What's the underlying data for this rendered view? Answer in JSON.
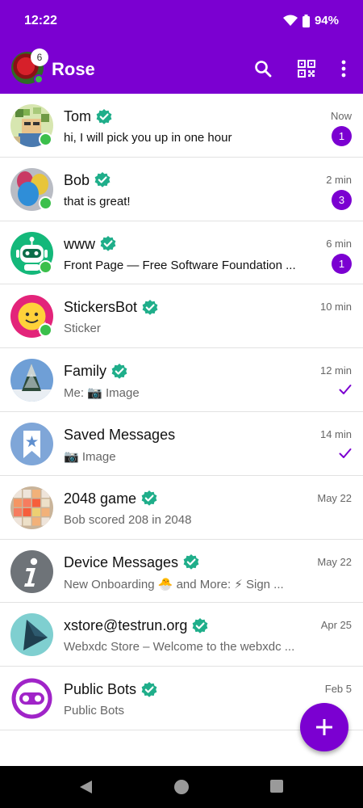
{
  "status_bar": {
    "time": "12:22",
    "battery": "94%"
  },
  "app_bar": {
    "title": "Rose",
    "account_badge": "6"
  },
  "colors": {
    "accent": "#7b00d1",
    "online": "#3bbf4b",
    "verified": "#1fae8a"
  },
  "chats": [
    {
      "name": "Tom",
      "preview": "hi, I will pick you up in one hour",
      "time": "Now",
      "unread": "1",
      "online": true,
      "verified": true
    },
    {
      "name": "Bob",
      "preview": "that is great!",
      "time": "2 min",
      "unread": "3",
      "online": true,
      "verified": true
    },
    {
      "name": "www",
      "preview": "Front Page — Free Software Foundation ...",
      "time": "6 min",
      "unread": "1",
      "online": true,
      "verified": true
    },
    {
      "name": "StickersBot",
      "preview": "Sticker",
      "time": "10 min",
      "online": true,
      "verified": true
    },
    {
      "name": "Family",
      "preview": "Me: 📷 Image",
      "time": "12 min",
      "delivered": true,
      "verified": true
    },
    {
      "name": "Saved Messages",
      "preview": "📷 Image",
      "time": "14 min",
      "delivered": true,
      "verified": false
    },
    {
      "name": "2048 game",
      "preview": "Bob scored 208 in 2048",
      "time": "May 22",
      "verified": true
    },
    {
      "name": "Device Messages",
      "preview": "New Onboarding 🐣 and More: ⚡ Sign ...",
      "time": "May 22",
      "verified": true
    },
    {
      "name": "xstore@testrun.org",
      "preview": "Webxdc Store – Welcome to the webxdc ...",
      "time": "Apr 25",
      "verified": true
    },
    {
      "name": "Public Bots",
      "preview": "Public Bots",
      "time": "Feb 5",
      "verified": true
    }
  ]
}
